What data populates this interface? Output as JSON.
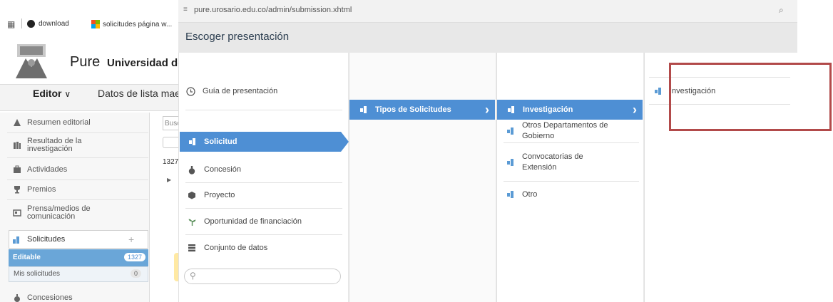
{
  "browser": {
    "bookmarks": [
      {
        "label": "download",
        "icon": "globe-icon"
      },
      {
        "label": "solicitudes página w...",
        "icon": "windows-icon"
      }
    ],
    "url": "pure.urosario.edu.co/admin/submission.xhtml"
  },
  "app": {
    "brand": "Pure",
    "university": "Universidad del Rosario",
    "editor_label": "Editor",
    "datos_label": "Datos de lista maestra",
    "search_placeholder": "Buscar",
    "count_text": "1327"
  },
  "sidebar": {
    "items": [
      {
        "label": "Resumen editorial",
        "icon": "editorial-icon"
      },
      {
        "label": "Resultado de la investigación",
        "icon": "books-icon"
      },
      {
        "label": "Actividades",
        "icon": "briefcase-icon"
      },
      {
        "label": "Premios",
        "icon": "trophy-icon"
      },
      {
        "label": "Prensa/medios de comunicación",
        "icon": "newspaper-icon"
      },
      {
        "label": "Solicitudes",
        "icon": "bar-chart-icon"
      },
      {
        "label": "Concesiones",
        "icon": "money-bag-icon"
      }
    ],
    "sub": {
      "editable": "Editable",
      "editable_count": "1327",
      "mine": "Mis solicitudes",
      "mine_count": "0"
    }
  },
  "dialog": {
    "title": "Escoger presentación",
    "col1": [
      {
        "label": "Guía de presentación",
        "icon": "help-circle-icon"
      },
      {
        "label": "Solicitud",
        "icon": "bar-chart-icon",
        "selected": true
      },
      {
        "label": "Concesión",
        "icon": "money-bag-icon"
      },
      {
        "label": "Proyecto",
        "icon": "cube-icon"
      },
      {
        "label": "Oportunidad de financiación",
        "icon": "sprout-icon"
      },
      {
        "label": "Conjunto de datos",
        "icon": "database-icon"
      }
    ],
    "col2": [
      {
        "label": "Tipos de Solicitudes",
        "icon": "bar-chart-icon",
        "selected": true
      }
    ],
    "col3": [
      {
        "label": "Investigación",
        "icon": "bar-chart-icon",
        "selected": true
      },
      {
        "label": "Otros Departamentos de Gobierno",
        "line1": "Otros Departamentos de",
        "line2": "Gobierno",
        "icon": "bar-chart-icon"
      },
      {
        "label": "Convocatorias de Extensión",
        "line1": "Convocatorias de",
        "line2": "Extensión",
        "icon": "bar-chart-icon"
      },
      {
        "label": "Otro",
        "icon": "bar-chart-icon"
      }
    ],
    "col4": [
      {
        "label": "Investigación",
        "icon": "bar-chart-icon"
      }
    ]
  },
  "colors": {
    "selected": "#4e8fd4",
    "highlight_frame": "#b24a4a",
    "dialog_header": "#e8e8e8"
  }
}
